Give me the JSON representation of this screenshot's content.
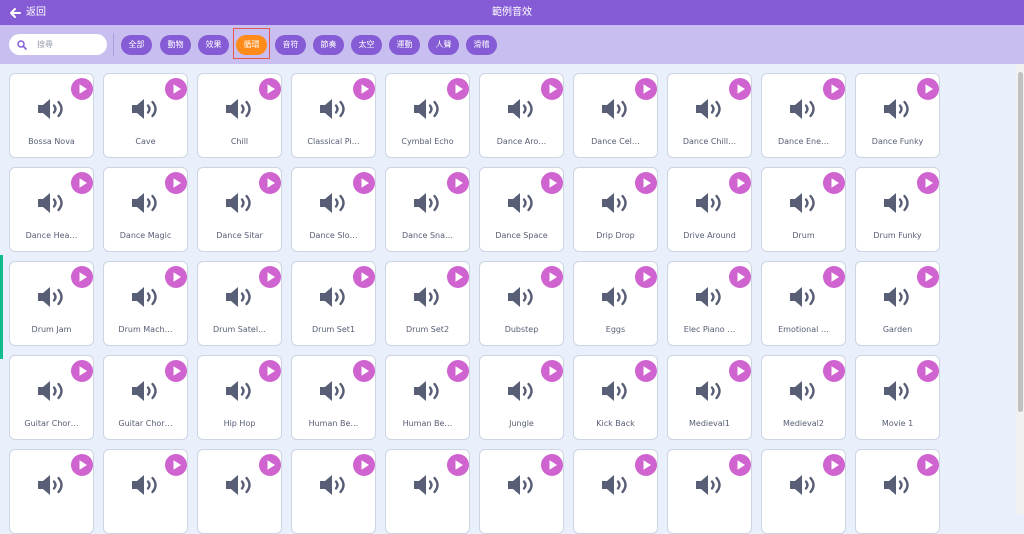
{
  "header": {
    "back_label": "返回",
    "title": "範例音效",
    "back_icon": "arrow-left-icon",
    "bg_color": "#855cd6"
  },
  "search": {
    "placeholder": "搜尋",
    "value": "",
    "icon": "search-icon"
  },
  "filters": [
    {
      "label": "全部",
      "active": false
    },
    {
      "label": "動物",
      "active": false
    },
    {
      "label": "效果",
      "active": false
    },
    {
      "label": "循環",
      "active": true
    },
    {
      "label": "音符",
      "active": false
    },
    {
      "label": "節奏",
      "active": false
    },
    {
      "label": "太空",
      "active": false
    },
    {
      "label": "運動",
      "active": false
    },
    {
      "label": "人聲",
      "active": false
    },
    {
      "label": "滑稽",
      "active": false
    }
  ],
  "colors": {
    "accent": "#855cd6",
    "active_filter": "#ff8c1a",
    "play_button": "#cf63cf",
    "speaker": "#575e75",
    "highlight": "#e5584a"
  },
  "sounds": [
    "Bossa Nova",
    "Cave",
    "Chill",
    "Classical Pi…",
    "Cymbal Echo",
    "Dance Aro…",
    "Dance Cel…",
    "Dance Chill…",
    "Dance Ene…",
    "Dance Funky",
    "Dance Hea…",
    "Dance Magic",
    "Dance Sitar",
    "Dance Slo…",
    "Dance Sna…",
    "Dance Space",
    "Drip Drop",
    "Drive Around",
    "Drum",
    "Drum Funky",
    "Drum Jam",
    "Drum Mach…",
    "Drum Satel…",
    "Drum Set1",
    "Drum Set2",
    "Dubstep",
    "Eggs",
    "Elec Piano …",
    "Emotional …",
    "Garden",
    "Guitar Chor…",
    "Guitar Chor…",
    "Hip Hop",
    "Human Be…",
    "Human Be…",
    "Jungle",
    "Kick Back",
    "Medieval1",
    "Medieval2",
    "Movie 1",
    "",
    "",
    "",
    "",
    "",
    "",
    "",
    "",
    "",
    ""
  ]
}
